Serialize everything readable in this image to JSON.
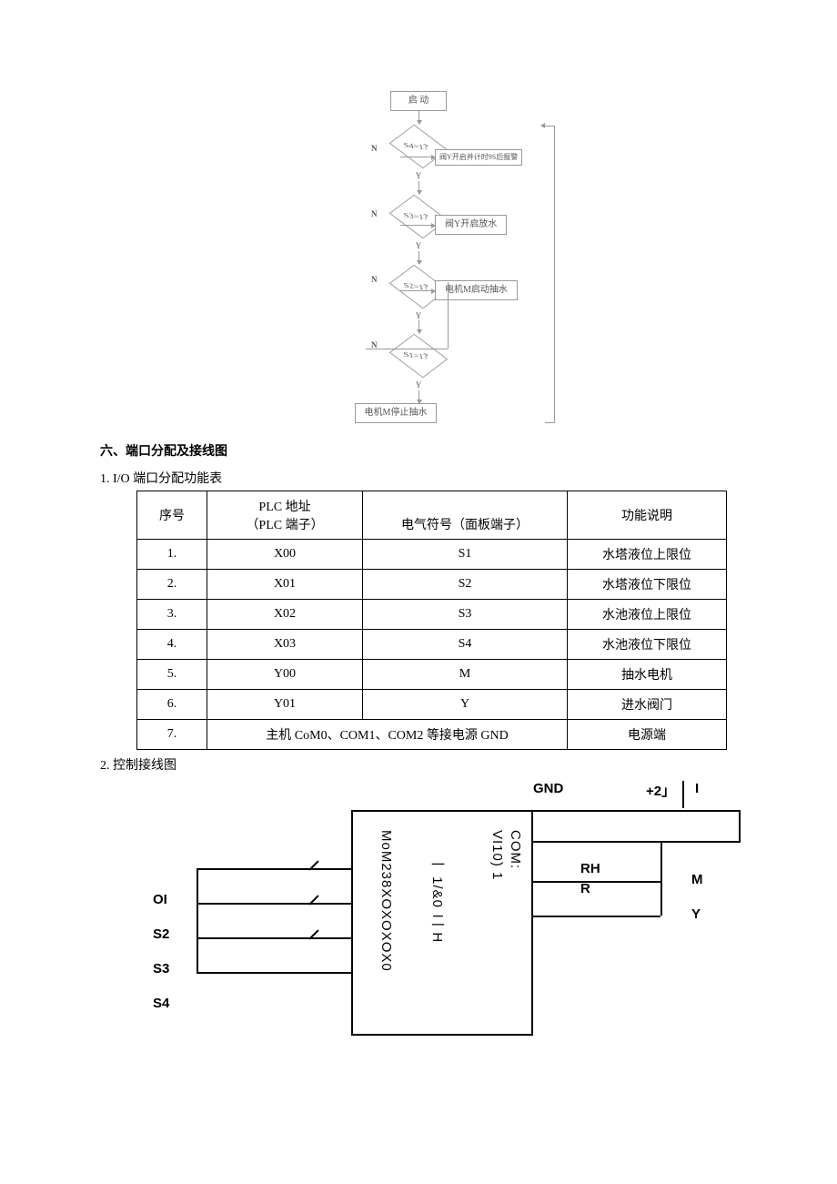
{
  "flowchart": {
    "start": "启 动",
    "d1": "S4=1？",
    "d2": "S3=1？",
    "d3": "S2=1？",
    "d4": "S1=1？",
    "y": "Y",
    "n": "N",
    "r1": "阀Y开启并计时9S后报警",
    "r2": "阀Y开启放水",
    "r3": "电机M启动抽水",
    "end": "电机M停止抽水"
  },
  "section_title": "六、端口分配及接线图",
  "sub1": "1. I/O 端口分配功能表",
  "sub2": "2. 控制接线图",
  "table": {
    "h_seq": "序号",
    "h_plc1": "PLC 地址",
    "h_plc2": "（PLC 端子）",
    "h_sym": "电气符号（面板端子）",
    "h_func": "功能说明",
    "rows": [
      {
        "seq": "1.",
        "plc": "X00",
        "sym": "S1",
        "func": "水塔液位上限位"
      },
      {
        "seq": "2.",
        "plc": "X01",
        "sym": "S2",
        "func": "水塔液位下限位"
      },
      {
        "seq": "3.",
        "plc": "X02",
        "sym": "S3",
        "func": "水池液位上限位"
      },
      {
        "seq": "4.",
        "plc": "X03",
        "sym": "S4",
        "func": "水池液位下限位"
      },
      {
        "seq": "5.",
        "plc": "Y00",
        "sym": "M",
        "func": "抽水电机"
      },
      {
        "seq": "6.",
        "plc": "Y01",
        "sym": "Y",
        "func": "进水阀门"
      }
    ],
    "row7_seq": "7.",
    "row7_merged": "主机 CoM0、COM1、COM2 等接电源 GND",
    "row7_func": "电源端"
  },
  "wiring": {
    "gnd": "GND",
    "plus2": "+2」",
    "iv": "I",
    "plc_vert1": "MoM238XOXOXOX0",
    "plc_vert2": "一 1/&0 二 H",
    "plc_vert3": "VI10) 1",
    "plc_vert4": "COM:",
    "rh": "RH",
    "r": "R",
    "m": "M",
    "y": "Y",
    "oi": "OI",
    "s2": "S2",
    "s3": "S3",
    "s4": "S4"
  }
}
